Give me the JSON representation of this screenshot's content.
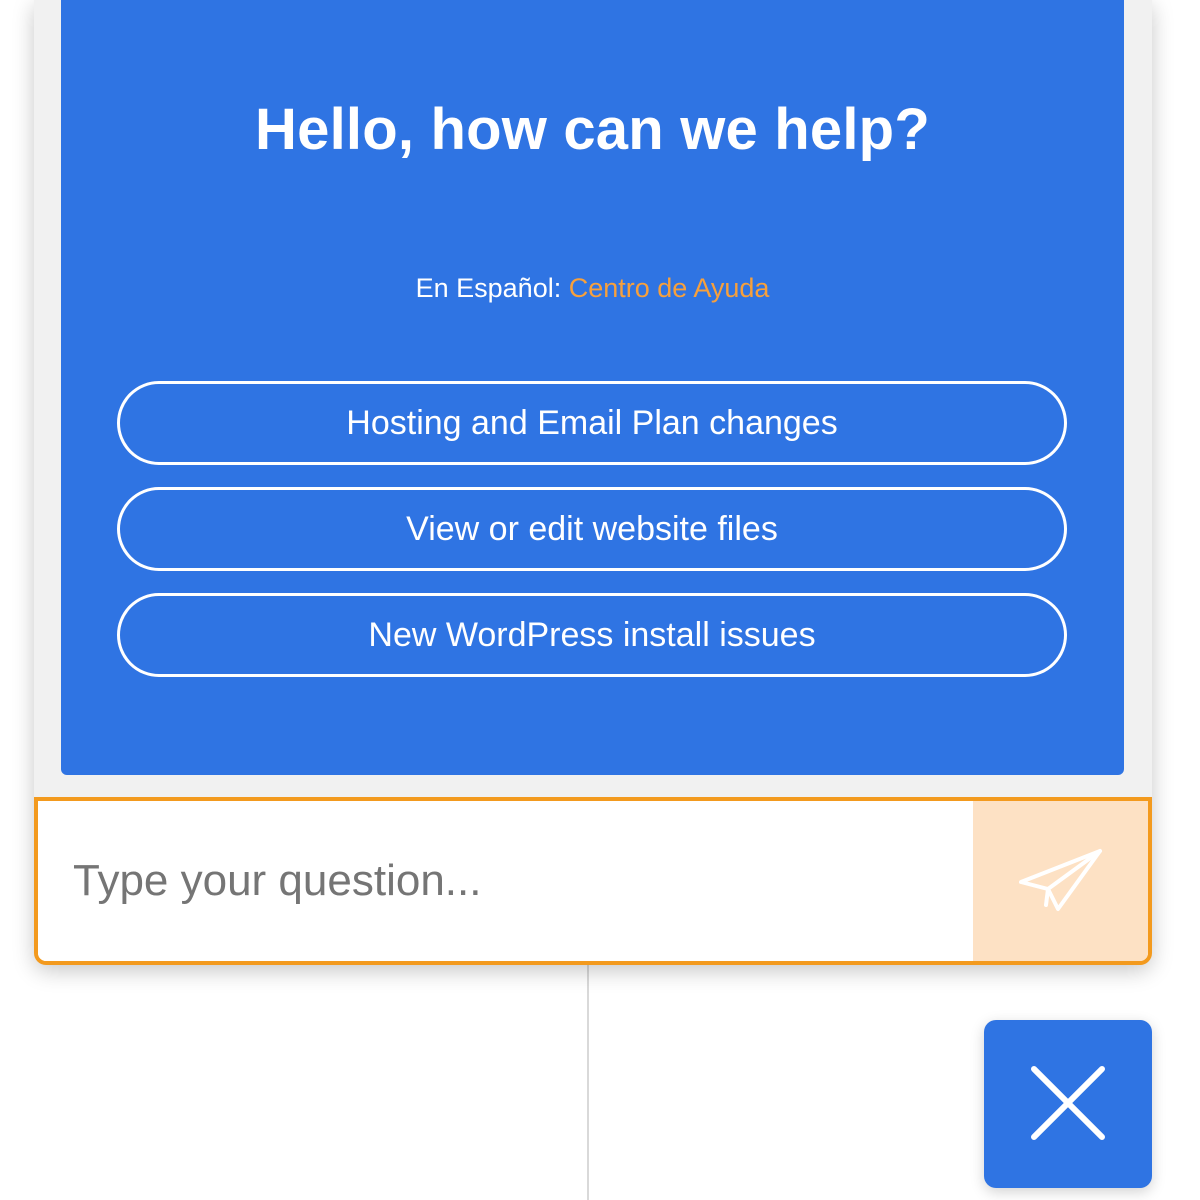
{
  "hero": {
    "title": "Hello, how can we help?",
    "spanish_prefix": "En Español:",
    "spanish_link": "Centro de Ayuda"
  },
  "options": [
    {
      "label": "Hosting and Email Plan changes"
    },
    {
      "label": "View or edit website files"
    },
    {
      "label": "New WordPress install issues"
    }
  ],
  "input": {
    "placeholder": "Type your question...",
    "value": ""
  },
  "icons": {
    "send": "paper-plane-icon",
    "close": "close-icon"
  },
  "colors": {
    "primary_blue": "#2f74e3",
    "accent_orange": "#f39a1e",
    "link_orange": "#f7a03c",
    "send_bg": "#fde1c4"
  }
}
